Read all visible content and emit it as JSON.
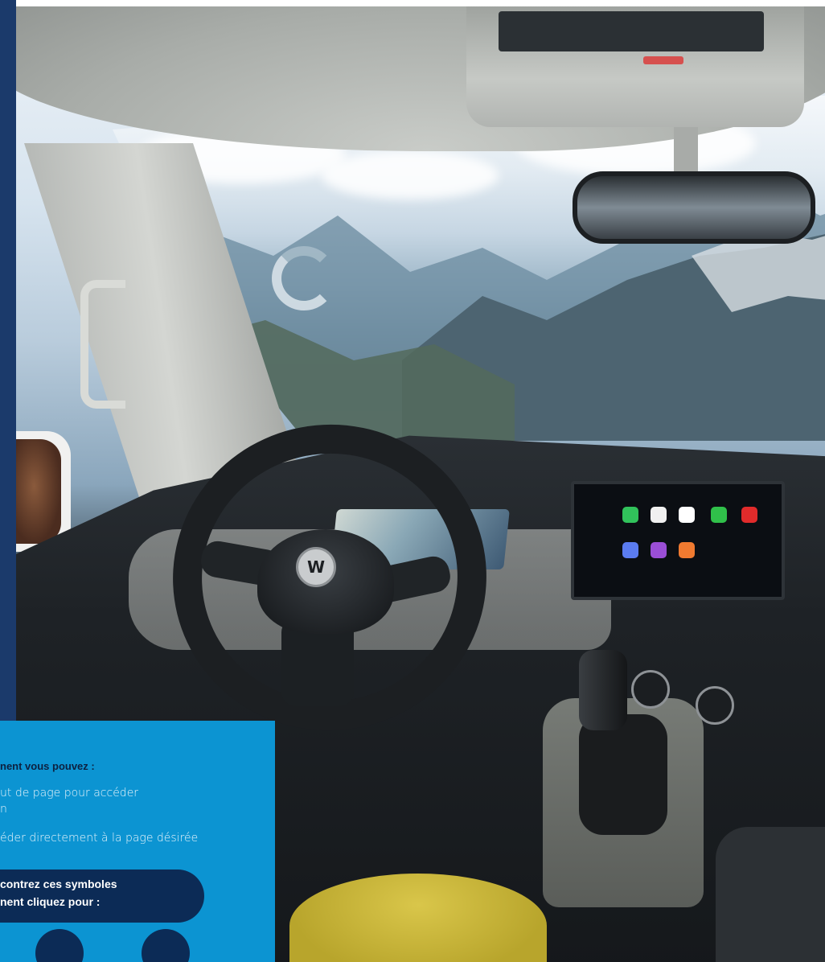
{
  "panel": {
    "heading": "nent vous pouvez :",
    "lines": [
      "ut de page pour accéder",
      "n",
      "éder directement à la page désirée"
    ],
    "callout": {
      "line1": "contrez ces symboles",
      "line2": "nent cliquez pour :"
    }
  },
  "colors": {
    "panel_bg": "#0c94d2",
    "callout_bg": "#0c2b56",
    "left_strip": "#1b3a6b"
  },
  "buttons": [
    {
      "name": "nav-round-button-left",
      "icon": "circle-icon"
    },
    {
      "name": "nav-round-button-right",
      "icon": "circle-icon"
    }
  ]
}
